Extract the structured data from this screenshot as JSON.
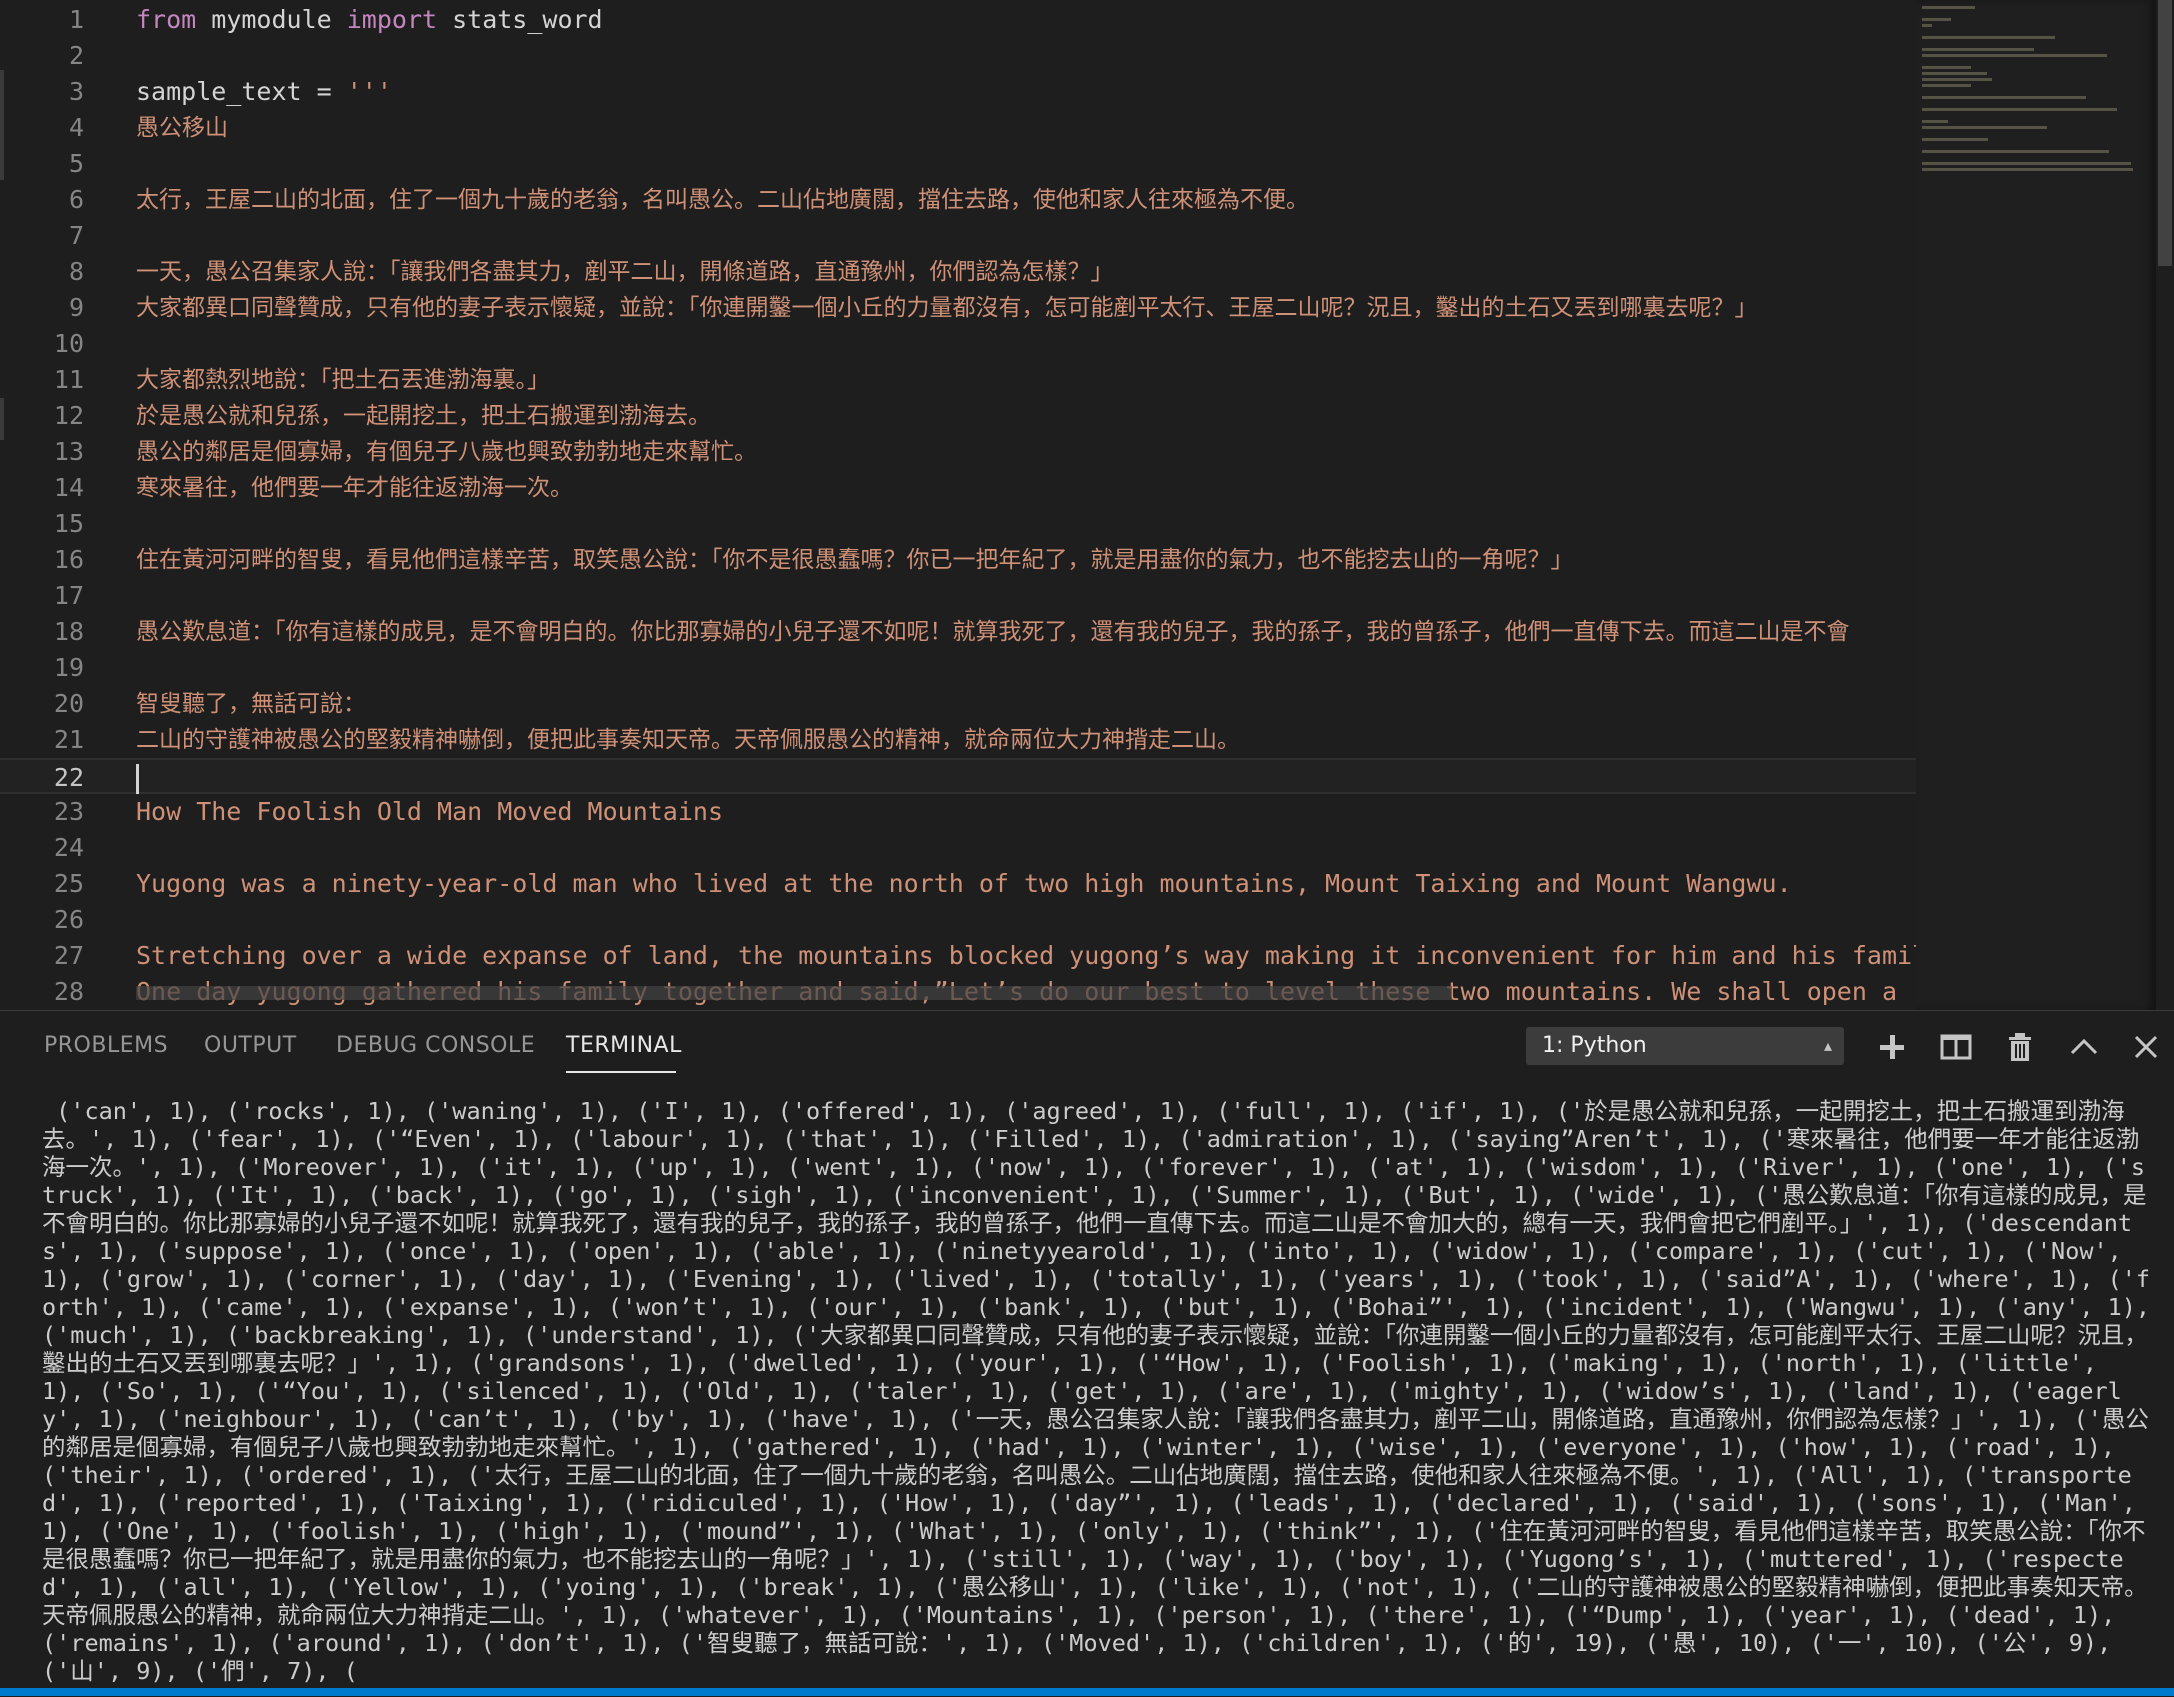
{
  "editor": {
    "lines": [
      {
        "num": "1",
        "segments": [
          {
            "t": "from",
            "c": "kw"
          },
          {
            "t": " mymodule ",
            "c": "plain"
          },
          {
            "t": "import",
            "c": "kw"
          },
          {
            "t": " stats_word",
            "c": "plain"
          }
        ]
      },
      {
        "num": "2",
        "segments": []
      },
      {
        "num": "3",
        "segments": [
          {
            "t": "sample_text = ",
            "c": "plain"
          },
          {
            "t": "'''",
            "c": "str"
          }
        ]
      },
      {
        "num": "4",
        "cjk": true,
        "segments": [
          {
            "t": "愚公移山",
            "c": "str"
          }
        ]
      },
      {
        "num": "5",
        "segments": []
      },
      {
        "num": "6",
        "cjk": true,
        "segments": [
          {
            "t": "太行，王屋二山的北面，住了一個九十歲的老翁，名叫愚公。二山佔地廣闊，擋住去路，使他和家人往來極為不便。",
            "c": "str"
          }
        ]
      },
      {
        "num": "7",
        "segments": []
      },
      {
        "num": "8",
        "cjk": true,
        "segments": [
          {
            "t": "一天，愚公召集家人說：「讓我們各盡其力，剷平二山，開條道路，直通豫州，你們認為怎樣？」",
            "c": "str"
          }
        ]
      },
      {
        "num": "9",
        "cjk": true,
        "segments": [
          {
            "t": "大家都異口同聲贊成，只有他的妻子表示懷疑，並說：「你連開鑿一個小丘的力量都沒有，怎可能剷平太行、王屋二山呢？況且，鑿出的土石又丟到哪裏去呢？」",
            "c": "str"
          }
        ]
      },
      {
        "num": "10",
        "segments": []
      },
      {
        "num": "11",
        "cjk": true,
        "segments": [
          {
            "t": "大家都熱烈地說：「把土石丟進渤海裏。」",
            "c": "str"
          }
        ]
      },
      {
        "num": "12",
        "cjk": true,
        "segments": [
          {
            "t": "於是愚公就和兒孫，一起開挖土，把土石搬運到渤海去。",
            "c": "str"
          }
        ]
      },
      {
        "num": "13",
        "cjk": true,
        "segments": [
          {
            "t": "愚公的鄰居是個寡婦，有個兒子八歲也興致勃勃地走來幫忙。",
            "c": "str"
          }
        ]
      },
      {
        "num": "14",
        "cjk": true,
        "segments": [
          {
            "t": "寒來暑往，他們要一年才能往返渤海一次。",
            "c": "str"
          }
        ]
      },
      {
        "num": "15",
        "segments": []
      },
      {
        "num": "16",
        "cjk": true,
        "segments": [
          {
            "t": "住在黃河河畔的智叟，看見他們這樣辛苦，取笑愚公說：「你不是很愚蠢嗎？你已一把年紀了，就是用盡你的氣力，也不能挖去山的一角呢？」",
            "c": "str"
          }
        ]
      },
      {
        "num": "17",
        "segments": []
      },
      {
        "num": "18",
        "cjk": true,
        "segments": [
          {
            "t": "愚公歎息道：「你有這樣的成見，是不會明白的。你比那寡婦的小兒子還不如呢！就算我死了，還有我的兒子，我的孫子，我的曾孫子，他們一直傳下去。而這二山是不會",
            "c": "str"
          }
        ]
      },
      {
        "num": "19",
        "segments": []
      },
      {
        "num": "20",
        "cjk": true,
        "segments": [
          {
            "t": "智叟聽了，無話可說：",
            "c": "str"
          }
        ]
      },
      {
        "num": "21",
        "cjk": true,
        "segments": [
          {
            "t": "二山的守護神被愚公的堅毅精神嚇倒，便把此事奏知天帝。天帝佩服愚公的精神，就命兩位大力神揹走二山。",
            "c": "str"
          }
        ]
      },
      {
        "num": "22",
        "current": true,
        "segments": []
      },
      {
        "num": "23",
        "segments": [
          {
            "t": "How The Foolish Old Man Moved Mountains",
            "c": "str"
          }
        ]
      },
      {
        "num": "24",
        "segments": []
      },
      {
        "num": "25",
        "segments": [
          {
            "t": "Yugong was a ninety-year-old man who lived at the north of two high mountains, Mount Taixing and Mount Wangwu.",
            "c": "str"
          }
        ]
      },
      {
        "num": "26",
        "segments": []
      },
      {
        "num": "27",
        "segments": [
          {
            "t": "Stretching over a wide expanse of land, the mountains blocked yugong’s way making it inconvenient for him and his family to",
            "c": "str"
          }
        ]
      },
      {
        "num": "28",
        "segments": [
          {
            "t": "One day yugong gathered his family together and said,”Let’s do our best to level these two mountains. We shall open a road t",
            "c": "str"
          }
        ]
      }
    ]
  },
  "panel": {
    "tabs": [
      "PROBLEMS",
      "OUTPUT",
      "DEBUG CONSOLE",
      "TERMINAL"
    ],
    "active_tab": "TERMINAL",
    "terminal_select": "1: Python",
    "buttons": {
      "add": "plus-icon",
      "split": "split-terminal-icon",
      "kill": "trash-icon",
      "maximize": "chevron-up-icon",
      "close": "close-icon"
    },
    "terminal_output": " ('can', 1), ('rocks', 1), ('waning', 1), ('I', 1), ('offered', 1), ('agreed', 1), ('full', 1), ('if', 1), ('於是愚公就和兒孫，一起開挖土，把土石搬運到渤海去。', 1), ('fear', 1), ('“Even', 1), ('labour', 1), ('that', 1), ('Filled', 1), ('admiration', 1), ('saying”Aren’t', 1), ('寒來暑往，他們要一年才能往返渤海一次。', 1), ('Moreover', 1), ('it', 1), ('up', 1), ('went', 1), ('now', 1), ('forever', 1), ('at', 1), ('wisdom', 1), ('River', 1), ('one', 1), ('struck', 1), ('It', 1), ('back', 1), ('go', 1), ('sigh', 1), ('inconvenient', 1), ('Summer', 1), ('But', 1), ('wide', 1), ('愚公歎息道：「你有這樣的成見，是不會明白的。你比那寡婦的小兒子還不如呢！就算我死了，還有我的兒子，我的孫子，我的曾孫子，他們一直傳下去。而這二山是不會加大的，總有一天，我們會把它們剷平。」', 1), ('descendants', 1), ('suppose', 1), ('once', 1), ('open', 1), ('able', 1), ('ninetyyearold', 1), ('into', 1), ('widow', 1), ('compare', 1), ('cut', 1), ('Now', 1), ('grow', 1), ('corner', 1), ('day', 1), ('Evening', 1), ('lived', 1), ('totally', 1), ('years', 1), ('took', 1), ('said”A', 1), ('where', 1), ('forth', 1), ('came', 1), ('expanse', 1), ('won’t', 1), ('our', 1), ('bank', 1), ('but', 1), ('Bohai”', 1), ('incident', 1), ('Wangwu', 1), ('any', 1), ('much', 1), ('backbreaking', 1), ('understand', 1), ('大家都異口同聲贊成，只有他的妻子表示懷疑，並說：「你連開鑿一個小丘的力量都沒有，怎可能剷平太行、王屋二山呢？況且，鑿出的土石又丟到哪裏去呢？」', 1), ('grandsons', 1), ('dwelled', 1), ('your', 1), ('“How', 1), ('Foolish', 1), ('making', 1), ('north', 1), ('little', 1), ('So', 1), ('“You', 1), ('silenced', 1), ('Old', 1), ('taler', 1), ('get', 1), ('are', 1), ('mighty', 1), ('widow’s', 1), ('land', 1), ('eagerly', 1), ('neighbour', 1), ('can’t', 1), ('by', 1), ('have', 1), ('一天，愚公召集家人說：「讓我們各盡其力，剷平二山，開條道路，直通豫州，你們認為怎樣？」', 1), ('愚公的鄰居是個寡婦，有個兒子八歲也興致勃勃地走來幫忙。', 1), ('gathered', 1), ('had', 1), ('winter', 1), ('wise', 1), ('everyone', 1), ('how', 1), ('road', 1), ('their', 1), ('ordered', 1), ('太行，王屋二山的北面，住了一個九十歲的老翁，名叫愚公。二山佔地廣闊，擋住去路，使他和家人往來極為不便。', 1), ('All', 1), ('transported', 1), ('reported', 1), ('Taixing', 1), ('ridiculed', 1), ('How', 1), ('day”', 1), ('leads', 1), ('declared', 1), ('said', 1), ('sons', 1), ('Man', 1), ('One', 1), ('foolish', 1), ('high', 1), ('mound”', 1), ('What', 1), ('only', 1), ('think”', 1), ('住在黃河河畔的智叟，看見他們這樣辛苦，取笑愚公說：「你不是很愚蠢嗎？你已一把年紀了，就是用盡你的氣力，也不能挖去山的一角呢？」', 1), ('still', 1), ('way', 1), ('boy', 1), ('Yugong’s', 1), ('muttered', 1), ('respected', 1), ('all', 1), ('Yellow', 1), ('yoing', 1), ('break', 1), ('愚公移山', 1), ('like', 1), ('not', 1), ('二山的守護神被愚公的堅毅精神嚇倒，便把此事奏知天帝。天帝佩服愚公的精神，就命兩位大力神揹走二山。', 1), ('whatever', 1), ('Mountains', 1), ('person', 1), ('there', 1), ('“Dump', 1), ('year', 1), ('dead', 1), ('remains', 1), ('around', 1), ('don’t', 1), ('智叟聽了，無話可說：', 1), ('Moved', 1), ('children', 1), ('的', 19), ('愚', 10), ('一', 10), ('公', 9), ('山', 9), ('們', 7), ("
  },
  "colors": {
    "editor_bg": "#1e1e1e",
    "keyword": "#c586c0",
    "string": "#ce9178",
    "line_number": "#858585",
    "accent": "#007acc"
  }
}
